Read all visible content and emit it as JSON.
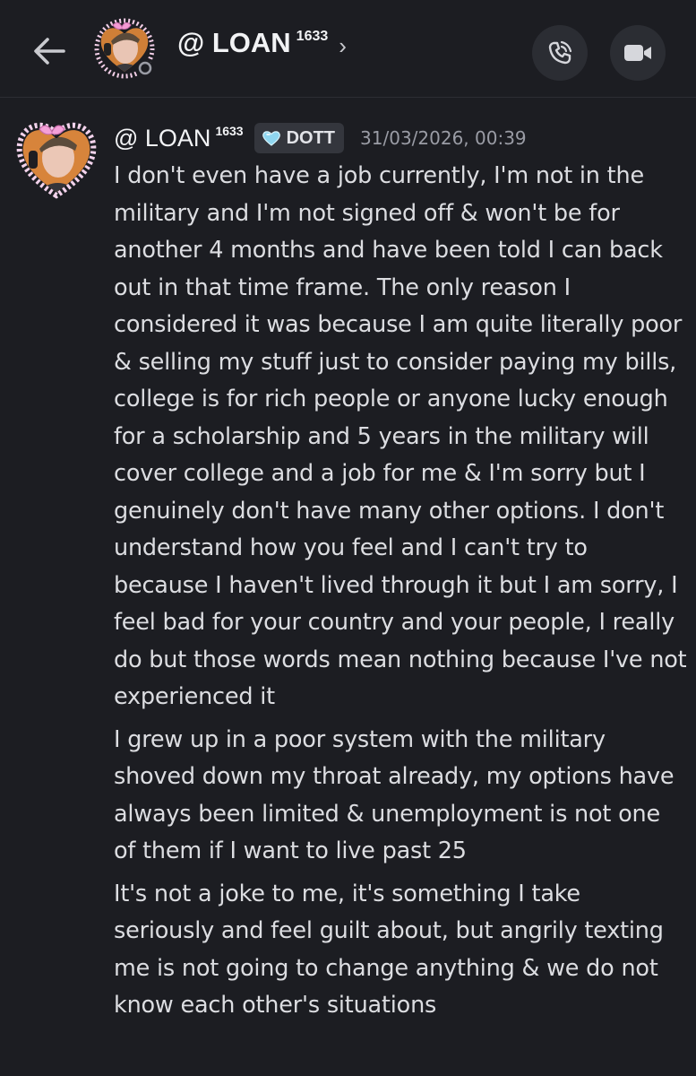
{
  "header": {
    "back_icon": "arrow-left-icon",
    "title": "@ LOAN",
    "title_sup": "1633",
    "chevron": "›",
    "call_icon": "phone-call-icon",
    "video_icon": "video-camera-icon"
  },
  "message": {
    "username": "@ LOAN",
    "username_sup": "1633",
    "tag_icon": "heart-gem-icon",
    "tag_label": "DOTT",
    "timestamp": "31/03/2026, 00:39",
    "paragraphs": [
      "I don't even have a job currently, I'm not in the military and I'm not signed off & won't be for another 4 months and have been told I can back out in that time frame. The only reason I considered it was because I am quite literally poor & selling my stuff just to consider paying my bills, college is for rich people or anyone lucky enough for a scholarship and 5 years in the military will cover college and a job for me & I'm sorry but I genuinely don't have many other options. I don't understand how you feel and I can't try to because I haven't lived through it but I am sorry, I feel bad for your country and your people, I really do but those words mean nothing because I've not experienced it",
      "I grew up in a poor system with the military shoved down my throat already, my options have always been limited & unemployment is not one of them if I want to live past 25",
      "It's not a joke to me, it's something I take seriously and feel guilt about, but angrily texting me is not going to change anything & we do not know each other's situations"
    ]
  },
  "colors": {
    "background": "#1c1d22",
    "text": "#dcdde1",
    "timestamp": "#9a9ca5",
    "tag_bg": "#34363d",
    "button_bg": "#2b2d33",
    "avatar_frame": "#f3b9e6"
  }
}
